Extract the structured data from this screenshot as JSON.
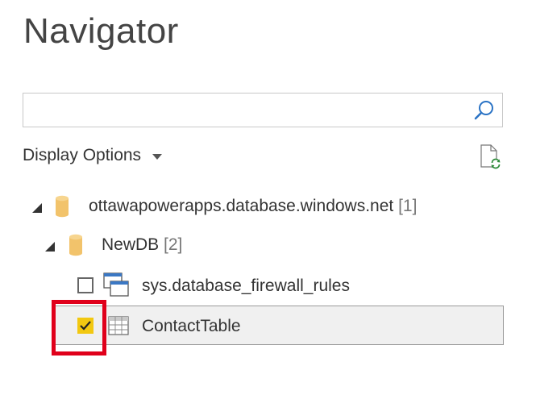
{
  "navigator": {
    "title": "Navigator",
    "search": {
      "value": "",
      "placeholder": ""
    },
    "display_options_label": "Display Options",
    "tree": {
      "server": {
        "name": "ottawapowerapps.database.windows.net",
        "count": "[1]"
      },
      "database": {
        "name": "NewDB",
        "count": "[2]"
      },
      "tables": [
        {
          "name": "sys.database_firewall_rules",
          "checked": false,
          "icon": "view-icon"
        },
        {
          "name": "ContactTable",
          "checked": true,
          "icon": "table-icon"
        }
      ]
    }
  },
  "colors": {
    "checkbox_checked": "#f2c811",
    "database_icon": "#f2c36b",
    "highlight_border": "#e0001b",
    "selected_row_bg": "#f0f0f0",
    "accent_blue": "#2a73c5"
  }
}
